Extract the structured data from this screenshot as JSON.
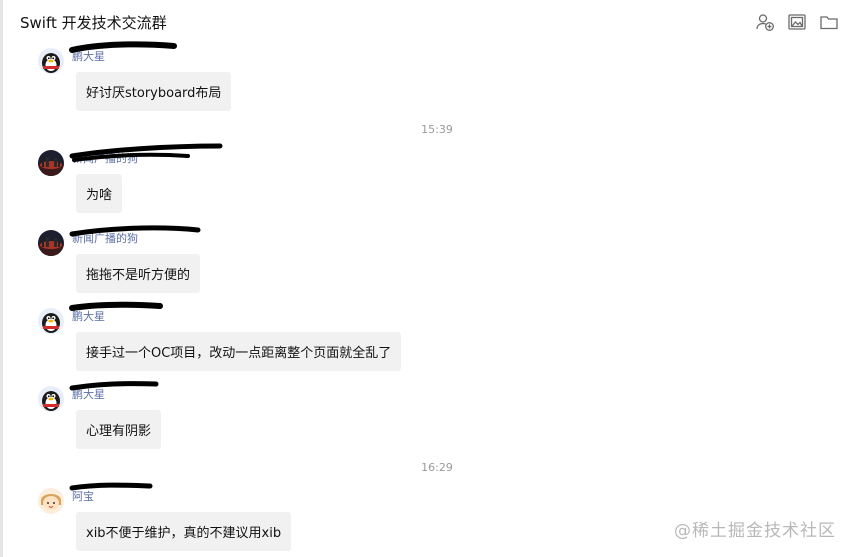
{
  "header": {
    "title": "Swift 开发技术交流群",
    "icons": [
      "add-member-icon",
      "image-icon",
      "folder-icon"
    ]
  },
  "messages": [
    {
      "sender": "鹏大星",
      "avatar": "penguin",
      "text": "好讨厌storyboard布局"
    },
    {
      "time": "15:39"
    },
    {
      "sender": "新闻广播的狗",
      "avatar": "city-night",
      "text": "为啥"
    },
    {
      "sender": "新闻广播的狗",
      "avatar": "city-night",
      "text": "拖拖不是听方便的"
    },
    {
      "sender": "鹏大星",
      "avatar": "penguin",
      "text": "接手过一个OC项目，改动一点距离整个页面就全乱了"
    },
    {
      "sender": "鹏大星",
      "avatar": "penguin",
      "text": "心理有阴影"
    },
    {
      "time": "16:29"
    },
    {
      "sender": "阿宝",
      "avatar": "cartoon-girl",
      "text": "xib不便于维护，真的不建议用xib"
    }
  ],
  "watermark": "@稀土掘金技术社区"
}
